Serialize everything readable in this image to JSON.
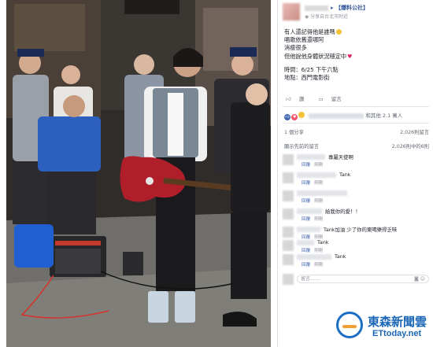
{
  "post": {
    "page_name": "【爆料公社】",
    "location": "分享自台北市附近",
    "lines": [
      "有人還記得他是誰嗎",
      "唱歌依舊還哪阿",
      "消瘦很多",
      "但他說他身體狀況穩定中"
    ],
    "time_line": "時間：6/25 下午六點",
    "place_line": "地點：西門電影街"
  },
  "actions": {
    "like": "讚",
    "comment": "留言"
  },
  "reactions": {
    "text": "和其他 2.1 萬人"
  },
  "stats": {
    "shares": "1 個分享",
    "count_right": "2,026則留言"
  },
  "comments_header": {
    "label": "顯示先前的留言",
    "count": "2,026則中的6則"
  },
  "comments": [
    {
      "text": "專屬天使啊",
      "reply": "回覆",
      "time": "剛剛"
    },
    {
      "text": "Tank",
      "reply": "回覆",
      "time": "剛剛"
    },
    {
      "text": "",
      "reply": "回覆",
      "time": "剛剛"
    },
    {
      "text": "給我你的愛！！",
      "reply": "回覆",
      "time": "剛剛"
    },
    {
      "text": "Tank加油 少了你的東喝樂得乏味",
      "reply": "回覆",
      "time": "剛剛"
    },
    {
      "text": "Tank",
      "reply": "回覆",
      "time": "剛剛"
    },
    {
      "text": "Tank",
      "reply": "回覆",
      "time": "剛剛"
    }
  ],
  "compose": {
    "placeholder": "留言……"
  },
  "watermark": {
    "cn": "東森新聞雲",
    "en": "ETtoday.net"
  },
  "colors": {
    "link": "#365899",
    "brand": "#1a66b6",
    "amp_red": "#c0392b",
    "guitar": "#b01e2a"
  }
}
